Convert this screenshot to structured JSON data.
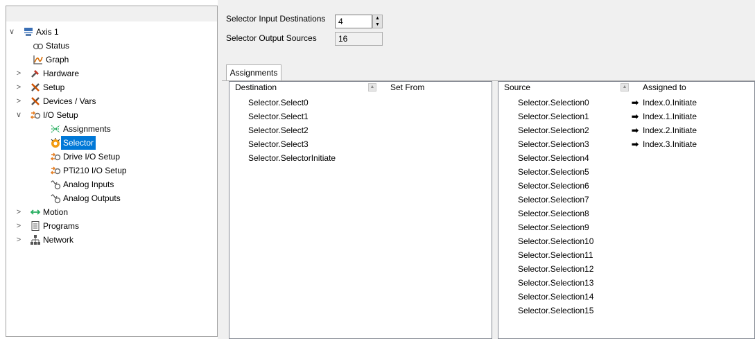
{
  "tree": {
    "items": [
      {
        "label": "Axis 1",
        "expander": "∨",
        "icon": "axis-icon"
      },
      {
        "label": "Status",
        "expander": "",
        "icon": "status-icon"
      },
      {
        "label": "Graph",
        "expander": "",
        "icon": "graph-icon"
      },
      {
        "label": "Hardware",
        "expander": ">",
        "icon": "hardware-icon"
      },
      {
        "label": "Setup",
        "expander": ">",
        "icon": "setup-icon"
      },
      {
        "label": "Devices / Vars",
        "expander": ">",
        "icon": "devices-icon"
      },
      {
        "label": "I/O Setup",
        "expander": "∨",
        "icon": "io-setup-icon"
      },
      {
        "label": "Assignments",
        "expander": "",
        "icon": "assignments-icon"
      },
      {
        "label": "Selector",
        "expander": "",
        "icon": "selector-icon",
        "selected": true
      },
      {
        "label": "Drive I/O Setup",
        "expander": "",
        "icon": "drive-io-icon"
      },
      {
        "label": "PTi210 I/O Setup",
        "expander": "",
        "icon": "pti210-io-icon"
      },
      {
        "label": "Analog Inputs",
        "expander": "",
        "icon": "analog-inputs-icon"
      },
      {
        "label": "Analog Outputs",
        "expander": "",
        "icon": "analog-outputs-icon"
      },
      {
        "label": "Motion",
        "expander": ">",
        "icon": "motion-icon"
      },
      {
        "label": "Programs",
        "expander": ">",
        "icon": "programs-icon"
      },
      {
        "label": "Network",
        "expander": ">",
        "icon": "network-icon"
      }
    ]
  },
  "selector": {
    "input_destinations_label": "Selector Input Destinations",
    "input_destinations_value": "4",
    "output_sources_label": "Selector Output Sources",
    "output_sources_value": "16"
  },
  "tab": {
    "label": "Assignments"
  },
  "destination_list": {
    "col1": "Destination",
    "col2": "Set From",
    "rows": [
      "Selector.Select0",
      "Selector.Select1",
      "Selector.Select2",
      "Selector.Select3",
      "Selector.SelectorInitiate"
    ]
  },
  "source_list": {
    "col1": "Source",
    "col2": "Assigned to",
    "rows": [
      {
        "source": "Selector.Selection0",
        "assigned": "Index.0.Initiate"
      },
      {
        "source": "Selector.Selection1",
        "assigned": "Index.1.Initiate"
      },
      {
        "source": "Selector.Selection2",
        "assigned": "Index.2.Initiate"
      },
      {
        "source": "Selector.Selection3",
        "assigned": "Index.3.Initiate"
      },
      {
        "source": "Selector.Selection4",
        "assigned": ""
      },
      {
        "source": "Selector.Selection5",
        "assigned": ""
      },
      {
        "source": "Selector.Selection6",
        "assigned": ""
      },
      {
        "source": "Selector.Selection7",
        "assigned": ""
      },
      {
        "source": "Selector.Selection8",
        "assigned": ""
      },
      {
        "source": "Selector.Selection9",
        "assigned": ""
      },
      {
        "source": "Selector.Selection10",
        "assigned": ""
      },
      {
        "source": "Selector.Selection11",
        "assigned": ""
      },
      {
        "source": "Selector.Selection12",
        "assigned": ""
      },
      {
        "source": "Selector.Selection13",
        "assigned": ""
      },
      {
        "source": "Selector.Selection14",
        "assigned": ""
      },
      {
        "source": "Selector.Selection15",
        "assigned": ""
      }
    ]
  },
  "colors": {
    "selection": "#0078d7",
    "panel_bg": "#f0f0f0"
  }
}
